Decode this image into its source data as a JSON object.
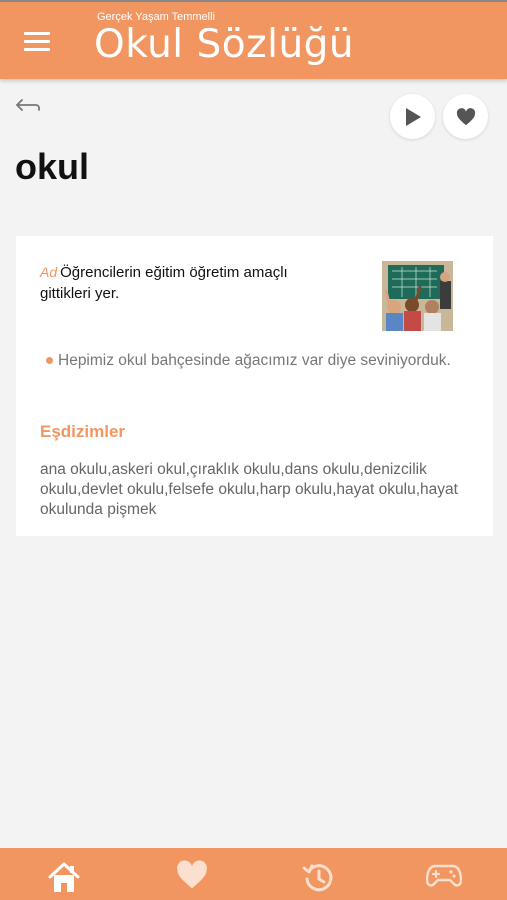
{
  "header": {
    "subtitle": "Gerçek Yaşam Temmelli",
    "title": "Okul Sözlüğü"
  },
  "entry": {
    "word": "okul",
    "part_of_speech": "Ad",
    "definition": "Öğrencilerin eğitim öğretim amaçlı gittikleri yer.",
    "example": "Hepimiz okul bahçesinde ağacımız var diye seviniyorduk.",
    "collocations_heading": "Eşdizimler",
    "collocations": "ana okulu,askeri okul,çıraklık okulu,dans okulu,denizcilik okulu,devlet okulu,felsefe okulu,harp okulu,hayat okulu,hayat okulunda pişmek"
  },
  "icons": {
    "menu": "hamburger-menu-icon",
    "back": "back-arrow-icon",
    "play": "play-icon",
    "favorite": "heart-icon",
    "nav": [
      "home-icon",
      "heart-icon",
      "history-icon",
      "gamepad-icon"
    ]
  },
  "colors": {
    "accent": "#f29661",
    "background": "#f3f3f3",
    "card": "#ffffff"
  }
}
